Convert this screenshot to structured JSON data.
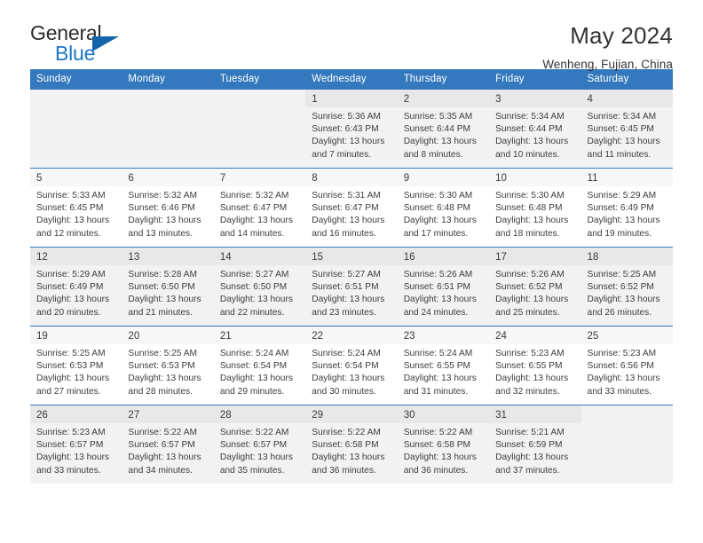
{
  "brand": {
    "name_part1": "General",
    "name_part2": "Blue",
    "accent_color": "#1a76c4",
    "triangle_color": "#1464aa"
  },
  "header": {
    "title": "May 2024",
    "subtitle": "Wenheng, Fujian, China"
  },
  "theme": {
    "header_row_bg": "#3479bd",
    "header_row_text": "#ffffff",
    "shaded_row_bg": "#f2f2f2",
    "daynum_bg": "#ececec"
  },
  "weekday_headers": [
    "Sunday",
    "Monday",
    "Tuesday",
    "Wednesday",
    "Thursday",
    "Friday",
    "Saturday"
  ],
  "weeks": [
    [
      {
        "day": "",
        "sunrise": "",
        "sunset": "",
        "daylight_line1": "",
        "daylight_line2": ""
      },
      {
        "day": "",
        "sunrise": "",
        "sunset": "",
        "daylight_line1": "",
        "daylight_line2": ""
      },
      {
        "day": "",
        "sunrise": "",
        "sunset": "",
        "daylight_line1": "",
        "daylight_line2": ""
      },
      {
        "day": "1",
        "sunrise": "Sunrise: 5:36 AM",
        "sunset": "Sunset: 6:43 PM",
        "daylight_line1": "Daylight: 13 hours",
        "daylight_line2": "and 7 minutes."
      },
      {
        "day": "2",
        "sunrise": "Sunrise: 5:35 AM",
        "sunset": "Sunset: 6:44 PM",
        "daylight_line1": "Daylight: 13 hours",
        "daylight_line2": "and 8 minutes."
      },
      {
        "day": "3",
        "sunrise": "Sunrise: 5:34 AM",
        "sunset": "Sunset: 6:44 PM",
        "daylight_line1": "Daylight: 13 hours",
        "daylight_line2": "and 10 minutes."
      },
      {
        "day": "4",
        "sunrise": "Sunrise: 5:34 AM",
        "sunset": "Sunset: 6:45 PM",
        "daylight_line1": "Daylight: 13 hours",
        "daylight_line2": "and 11 minutes."
      }
    ],
    [
      {
        "day": "5",
        "sunrise": "Sunrise: 5:33 AM",
        "sunset": "Sunset: 6:45 PM",
        "daylight_line1": "Daylight: 13 hours",
        "daylight_line2": "and 12 minutes."
      },
      {
        "day": "6",
        "sunrise": "Sunrise: 5:32 AM",
        "sunset": "Sunset: 6:46 PM",
        "daylight_line1": "Daylight: 13 hours",
        "daylight_line2": "and 13 minutes."
      },
      {
        "day": "7",
        "sunrise": "Sunrise: 5:32 AM",
        "sunset": "Sunset: 6:47 PM",
        "daylight_line1": "Daylight: 13 hours",
        "daylight_line2": "and 14 minutes."
      },
      {
        "day": "8",
        "sunrise": "Sunrise: 5:31 AM",
        "sunset": "Sunset: 6:47 PM",
        "daylight_line1": "Daylight: 13 hours",
        "daylight_line2": "and 16 minutes."
      },
      {
        "day": "9",
        "sunrise": "Sunrise: 5:30 AM",
        "sunset": "Sunset: 6:48 PM",
        "daylight_line1": "Daylight: 13 hours",
        "daylight_line2": "and 17 minutes."
      },
      {
        "day": "10",
        "sunrise": "Sunrise: 5:30 AM",
        "sunset": "Sunset: 6:48 PM",
        "daylight_line1": "Daylight: 13 hours",
        "daylight_line2": "and 18 minutes."
      },
      {
        "day": "11",
        "sunrise": "Sunrise: 5:29 AM",
        "sunset": "Sunset: 6:49 PM",
        "daylight_line1": "Daylight: 13 hours",
        "daylight_line2": "and 19 minutes."
      }
    ],
    [
      {
        "day": "12",
        "sunrise": "Sunrise: 5:29 AM",
        "sunset": "Sunset: 6:49 PM",
        "daylight_line1": "Daylight: 13 hours",
        "daylight_line2": "and 20 minutes."
      },
      {
        "day": "13",
        "sunrise": "Sunrise: 5:28 AM",
        "sunset": "Sunset: 6:50 PM",
        "daylight_line1": "Daylight: 13 hours",
        "daylight_line2": "and 21 minutes."
      },
      {
        "day": "14",
        "sunrise": "Sunrise: 5:27 AM",
        "sunset": "Sunset: 6:50 PM",
        "daylight_line1": "Daylight: 13 hours",
        "daylight_line2": "and 22 minutes."
      },
      {
        "day": "15",
        "sunrise": "Sunrise: 5:27 AM",
        "sunset": "Sunset: 6:51 PM",
        "daylight_line1": "Daylight: 13 hours",
        "daylight_line2": "and 23 minutes."
      },
      {
        "day": "16",
        "sunrise": "Sunrise: 5:26 AM",
        "sunset": "Sunset: 6:51 PM",
        "daylight_line1": "Daylight: 13 hours",
        "daylight_line2": "and 24 minutes."
      },
      {
        "day": "17",
        "sunrise": "Sunrise: 5:26 AM",
        "sunset": "Sunset: 6:52 PM",
        "daylight_line1": "Daylight: 13 hours",
        "daylight_line2": "and 25 minutes."
      },
      {
        "day": "18",
        "sunrise": "Sunrise: 5:25 AM",
        "sunset": "Sunset: 6:52 PM",
        "daylight_line1": "Daylight: 13 hours",
        "daylight_line2": "and 26 minutes."
      }
    ],
    [
      {
        "day": "19",
        "sunrise": "Sunrise: 5:25 AM",
        "sunset": "Sunset: 6:53 PM",
        "daylight_line1": "Daylight: 13 hours",
        "daylight_line2": "and 27 minutes."
      },
      {
        "day": "20",
        "sunrise": "Sunrise: 5:25 AM",
        "sunset": "Sunset: 6:53 PM",
        "daylight_line1": "Daylight: 13 hours",
        "daylight_line2": "and 28 minutes."
      },
      {
        "day": "21",
        "sunrise": "Sunrise: 5:24 AM",
        "sunset": "Sunset: 6:54 PM",
        "daylight_line1": "Daylight: 13 hours",
        "daylight_line2": "and 29 minutes."
      },
      {
        "day": "22",
        "sunrise": "Sunrise: 5:24 AM",
        "sunset": "Sunset: 6:54 PM",
        "daylight_line1": "Daylight: 13 hours",
        "daylight_line2": "and 30 minutes."
      },
      {
        "day": "23",
        "sunrise": "Sunrise: 5:24 AM",
        "sunset": "Sunset: 6:55 PM",
        "daylight_line1": "Daylight: 13 hours",
        "daylight_line2": "and 31 minutes."
      },
      {
        "day": "24",
        "sunrise": "Sunrise: 5:23 AM",
        "sunset": "Sunset: 6:55 PM",
        "daylight_line1": "Daylight: 13 hours",
        "daylight_line2": "and 32 minutes."
      },
      {
        "day": "25",
        "sunrise": "Sunrise: 5:23 AM",
        "sunset": "Sunset: 6:56 PM",
        "daylight_line1": "Daylight: 13 hours",
        "daylight_line2": "and 33 minutes."
      }
    ],
    [
      {
        "day": "26",
        "sunrise": "Sunrise: 5:23 AM",
        "sunset": "Sunset: 6:57 PM",
        "daylight_line1": "Daylight: 13 hours",
        "daylight_line2": "and 33 minutes."
      },
      {
        "day": "27",
        "sunrise": "Sunrise: 5:22 AM",
        "sunset": "Sunset: 6:57 PM",
        "daylight_line1": "Daylight: 13 hours",
        "daylight_line2": "and 34 minutes."
      },
      {
        "day": "28",
        "sunrise": "Sunrise: 5:22 AM",
        "sunset": "Sunset: 6:57 PM",
        "daylight_line1": "Daylight: 13 hours",
        "daylight_line2": "and 35 minutes."
      },
      {
        "day": "29",
        "sunrise": "Sunrise: 5:22 AM",
        "sunset": "Sunset: 6:58 PM",
        "daylight_line1": "Daylight: 13 hours",
        "daylight_line2": "and 36 minutes."
      },
      {
        "day": "30",
        "sunrise": "Sunrise: 5:22 AM",
        "sunset": "Sunset: 6:58 PM",
        "daylight_line1": "Daylight: 13 hours",
        "daylight_line2": "and 36 minutes."
      },
      {
        "day": "31",
        "sunrise": "Sunrise: 5:21 AM",
        "sunset": "Sunset: 6:59 PM",
        "daylight_line1": "Daylight: 13 hours",
        "daylight_line2": "and 37 minutes."
      },
      {
        "day": "",
        "sunrise": "",
        "sunset": "",
        "daylight_line1": "",
        "daylight_line2": ""
      }
    ]
  ]
}
